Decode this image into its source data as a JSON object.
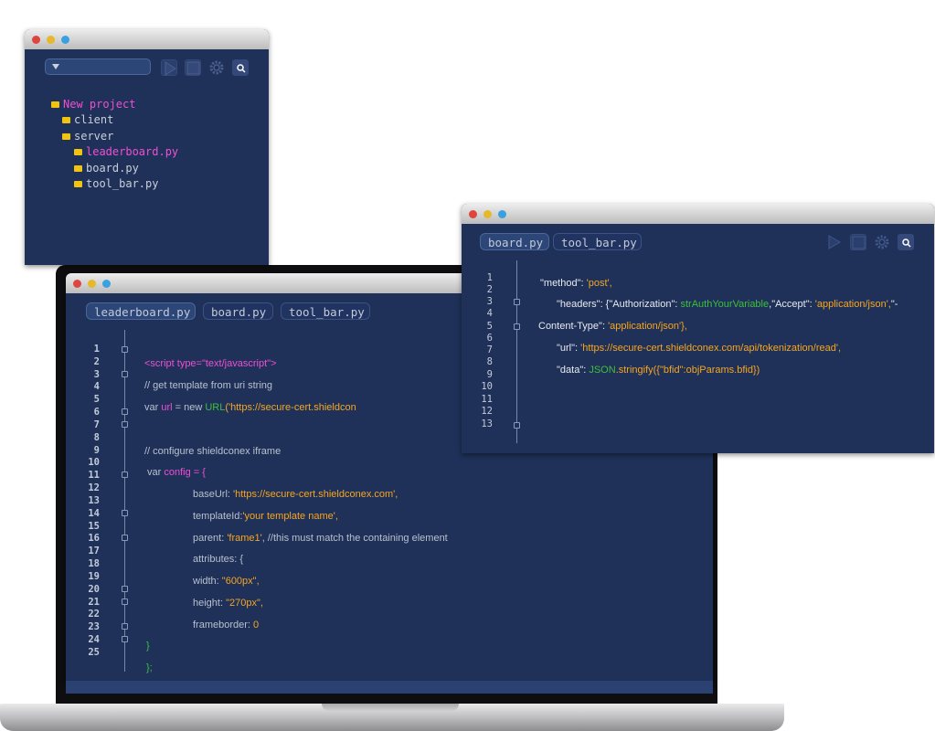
{
  "explorer": {
    "tree": [
      {
        "label": "New project",
        "highlight": true
      },
      {
        "label": "client",
        "highlight": false
      },
      {
        "label": "server",
        "highlight": false
      },
      {
        "label": "leaderboard.py",
        "highlight": true
      },
      {
        "label": "board.py",
        "highlight": false
      },
      {
        "label": "tool_bar.py",
        "highlight": false
      }
    ]
  },
  "main_editor": {
    "tabs": [
      "leaderboard.py",
      "board.py",
      "tool_bar.py"
    ],
    "line_numbers": [
      "1",
      "2",
      "3",
      "4",
      "5",
      "6",
      "7",
      "8",
      "9",
      "10",
      "11",
      "12",
      "13",
      "14",
      "15",
      "16",
      "17",
      "18",
      "19",
      "20",
      "21",
      "22",
      "23",
      "24",
      "25"
    ],
    "code": {
      "l1": "<script type=\"text/javascript\">",
      "l2": "// get template from uri string",
      "l3a": "var ",
      "l3b": "url",
      "l3c": " = new ",
      "l3d": "URL",
      "l3e": "('https://secure-cert.shieldcon",
      "l4": "// configure shieldconex iframe",
      "l5a": "var ",
      "l5b": "config = {",
      "l6a": "baseUrl: ",
      "l6b": "'https://secure-cert.shieldconex.com',",
      "l7a": "templateId:",
      "l7b": "'your template name',",
      "l8a": "parent: ",
      "l8b": "'frame1'",
      "l8c": ", //this must match the containing element",
      "l9": "attributes: {",
      "l10a": "width: ",
      "l10b": "\"600px\",",
      "l11a": "height: ",
      "l11b": "\"270px\",",
      "l12a": "frameborder: ",
      "l12b": "0",
      "l13": "}",
      "l14": "};"
    }
  },
  "side_editor": {
    "tabs": [
      "board.py",
      "tool_bar.py"
    ],
    "line_numbers": [
      "1",
      "2",
      "3",
      "4",
      "5",
      "6",
      "7",
      "8",
      "9",
      "10",
      "11",
      "12",
      "13"
    ],
    "code": {
      "r1a": "\"method\"",
      "r1b": ": ",
      "r1c": "'post',",
      "r2a": "\"headers\"",
      "r2b": ": {",
      "r2c": "\"Authorization\"",
      "r2d": ": ",
      "r2e": "strAuthYourVariable",
      "r2f": ",",
      "r2g": "\"Accept\"",
      "r2h": ": ",
      "r2i": "'application/json',",
      "r2j": "\"-",
      "r3a": "Content-Type\"",
      "r3b": ": ",
      "r3c": "'application/json'},",
      "r4a": "\"url\"",
      "r4b": ": ",
      "r4c": "'https://secure-cert.shieldconex.com/api/tokenization/read',",
      "r5a": "\"data\"",
      "r5b": ": ",
      "r5c": "JSON",
      "r5d": ".stringify({\"bfid\":objParams.bfid})"
    }
  },
  "icons": [
    "dropdown-arrow-icon",
    "play-icon",
    "stop-icon",
    "settings-gear-icon",
    "search-icon",
    "folder-icon",
    "fold-marker-icon"
  ],
  "colors": {
    "editor_bg": "#1f3158",
    "keyword_pink": "#ee4fd3",
    "string_orange": "#f5a623",
    "type_green": "#3fbf3f",
    "folder_yellow": "#f1c40f",
    "comment_grey": "#b9c0cf"
  }
}
